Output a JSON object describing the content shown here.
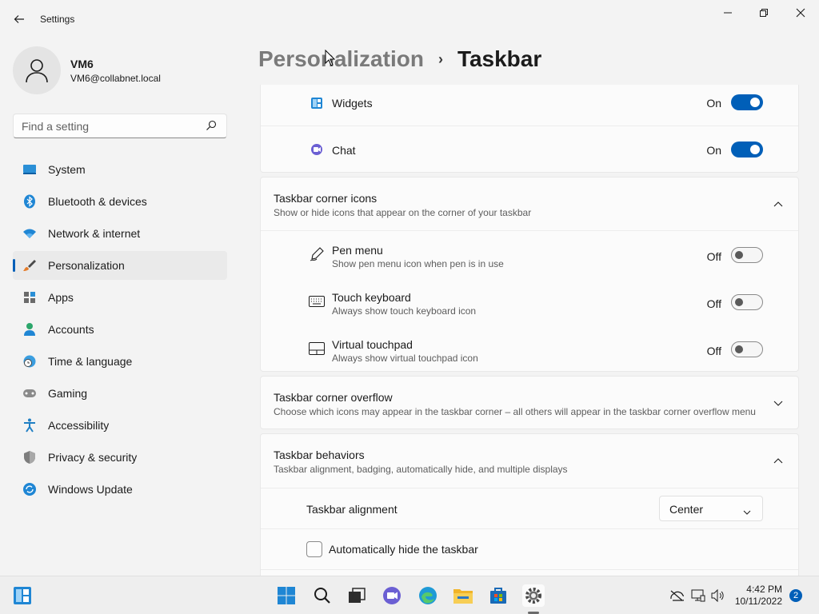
{
  "app": {
    "title": "Settings"
  },
  "user": {
    "name": "VM6",
    "email": "VM6@collabnet.local"
  },
  "search": {
    "placeholder": "Find a setting"
  },
  "nav": {
    "items": [
      {
        "label": "System",
        "icon": "system-icon"
      },
      {
        "label": "Bluetooth & devices",
        "icon": "bluetooth-icon"
      },
      {
        "label": "Network & internet",
        "icon": "wifi-icon"
      },
      {
        "label": "Personalization",
        "icon": "brush-icon",
        "active": true
      },
      {
        "label": "Apps",
        "icon": "apps-icon"
      },
      {
        "label": "Accounts",
        "icon": "accounts-icon"
      },
      {
        "label": "Time & language",
        "icon": "clock-globe-icon"
      },
      {
        "label": "Gaming",
        "icon": "gamepad-icon"
      },
      {
        "label": "Accessibility",
        "icon": "accessibility-icon"
      },
      {
        "label": "Privacy & security",
        "icon": "shield-icon"
      },
      {
        "label": "Windows Update",
        "icon": "update-icon"
      }
    ]
  },
  "header": {
    "parent": "Personalization",
    "separator": "›",
    "current": "Taskbar"
  },
  "taskbar_items": {
    "widgets": {
      "label": "Widgets",
      "state": "On"
    },
    "chat": {
      "label": "Chat",
      "state": "On"
    }
  },
  "corner_icons": {
    "title": "Taskbar corner icons",
    "description": "Show or hide icons that appear on the corner of your taskbar",
    "items": [
      {
        "label": "Pen menu",
        "description": "Show pen menu icon when pen is in use",
        "state": "Off"
      },
      {
        "label": "Touch keyboard",
        "description": "Always show touch keyboard icon",
        "state": "Off"
      },
      {
        "label": "Virtual touchpad",
        "description": "Always show virtual touchpad icon",
        "state": "Off"
      }
    ]
  },
  "corner_overflow": {
    "title": "Taskbar corner overflow",
    "description": "Choose which icons may appear in the taskbar corner – all others will appear in the taskbar corner overflow menu"
  },
  "behaviors": {
    "title": "Taskbar behaviors",
    "description": "Taskbar alignment, badging, automatically hide, and multiple displays",
    "alignment_label": "Taskbar alignment",
    "alignment_value": "Center",
    "autohide_label": "Automatically hide the taskbar"
  },
  "system_tray": {
    "time": "4:42 PM",
    "date": "10/11/2022",
    "notifications": "2"
  },
  "colors": {
    "accent": "#005fb8",
    "background": "#f3f3f3",
    "card": "#fbfbfb"
  }
}
